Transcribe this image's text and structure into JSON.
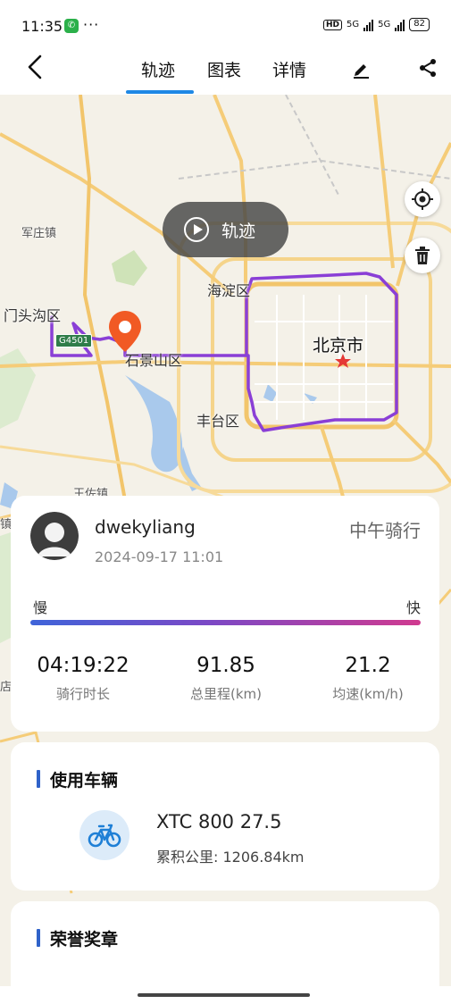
{
  "status_bar": {
    "time": "11:35",
    "network_hd": "HD",
    "signal_1": "5G",
    "signal_2": "5G",
    "battery": "82"
  },
  "nav": {
    "tabs": [
      {
        "label": "轨迹",
        "active": true
      },
      {
        "label": "图表",
        "active": false
      },
      {
        "label": "详情",
        "active": false
      }
    ],
    "accent": "#1e88e5"
  },
  "map": {
    "labels": {
      "junzhuang": "军庄镇",
      "mentougou": "门头沟区",
      "haidian": "海淀区",
      "shijingshan": "石景山区",
      "beijing": "北京市",
      "fengtai": "丰台区",
      "wangzuo": "王佐镇",
      "edge_zhen": "镇",
      "edge_dian": "店"
    },
    "road_shield": "G4501",
    "route_color": "#8a3fd6",
    "play_track_label": "轨迹"
  },
  "ride": {
    "username": "dwekyliang",
    "datetime": "2024-09-17 11:01",
    "ride_type": "中午骑行",
    "speed_slow": "慢",
    "speed_fast": "快",
    "stats": [
      {
        "value": "04:19:22",
        "label": "骑行时长"
      },
      {
        "value": "91.85",
        "label": "总里程(km)"
      },
      {
        "value": "21.2",
        "label": "均速(km/h)"
      }
    ]
  },
  "vehicle": {
    "section_title": "使用车辆",
    "name": "XTC 800 27.5",
    "mileage": "累积公里: 1206.84km"
  },
  "medals": {
    "section_title": "荣誉奖章"
  }
}
